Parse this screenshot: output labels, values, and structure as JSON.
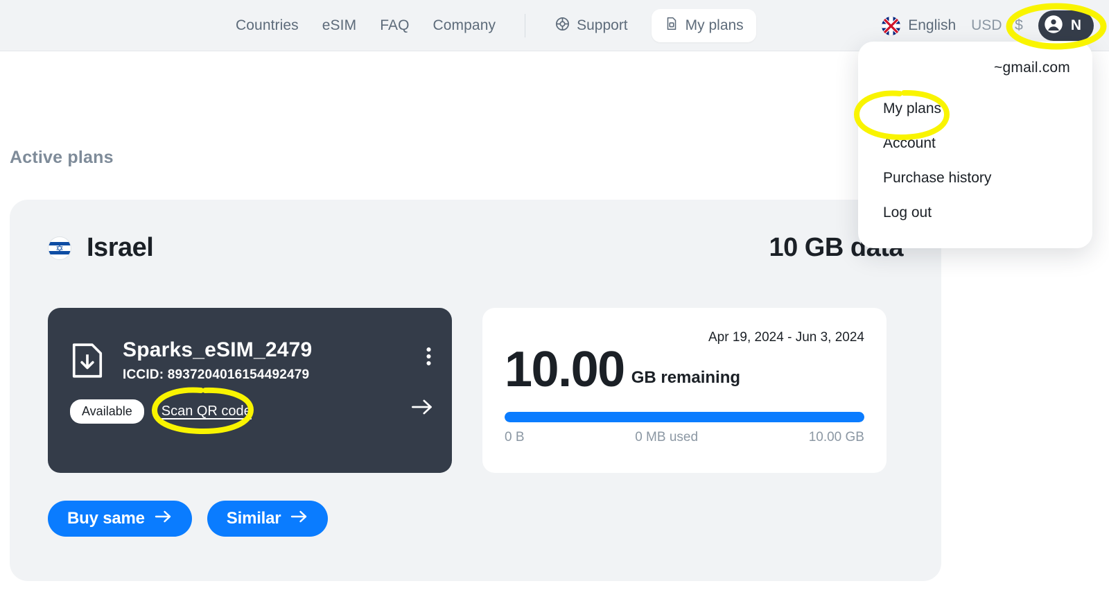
{
  "header": {
    "nav": [
      {
        "label": "Countries",
        "icon": ""
      },
      {
        "label": "eSIM",
        "icon": ""
      },
      {
        "label": "FAQ",
        "icon": ""
      },
      {
        "label": "Company",
        "icon": ""
      }
    ],
    "support": {
      "label": "Support",
      "icon": "life-ring-icon"
    },
    "my_plans": {
      "label": "My plans",
      "icon": "sim-card-icon"
    },
    "language": {
      "label": "English",
      "icon": "uk-flag-icon"
    },
    "currency": "USD · $",
    "account": {
      "initial": "N",
      "icon": "user-avatar-icon"
    }
  },
  "dropdown": {
    "email": "~gmail.com",
    "items": [
      {
        "label": "My plans"
      },
      {
        "label": "Account"
      },
      {
        "label": "Purchase history"
      },
      {
        "label": "Log out"
      }
    ]
  },
  "main": {
    "page_title": "Active plans",
    "plan": {
      "country": "Israel",
      "country_flag": "israel-flag-icon",
      "data_size": "10 GB data",
      "esim": {
        "name": "Sparks_eSIM_2479",
        "iccid": "ICCID: 8937204016154492479",
        "status_badge": "Available",
        "qr_link": "Scan QR code",
        "icon": "sim-download-icon",
        "menu_icon": "three-dots-vertical-icon",
        "go_icon": "arrow-right-icon"
      },
      "usage": {
        "dates": "Apr 19, 2024 - Jun 3, 2024",
        "remaining_value": "10.00",
        "remaining_unit": "GB remaining",
        "bar_min_label": "0 B",
        "bar_used_label": "0 MB used",
        "bar_max_label": "10.00 GB",
        "bar_percent": 100
      },
      "actions": [
        {
          "label": "Buy same",
          "icon": "arrow-right-icon"
        },
        {
          "label": "Similar",
          "icon": "arrow-right-icon"
        }
      ]
    }
  },
  "annotations": {
    "color": "#f9f400",
    "highlights": [
      "account-button-circle",
      "my-plans-menu-circle",
      "scan-qr-code-circle"
    ]
  }
}
